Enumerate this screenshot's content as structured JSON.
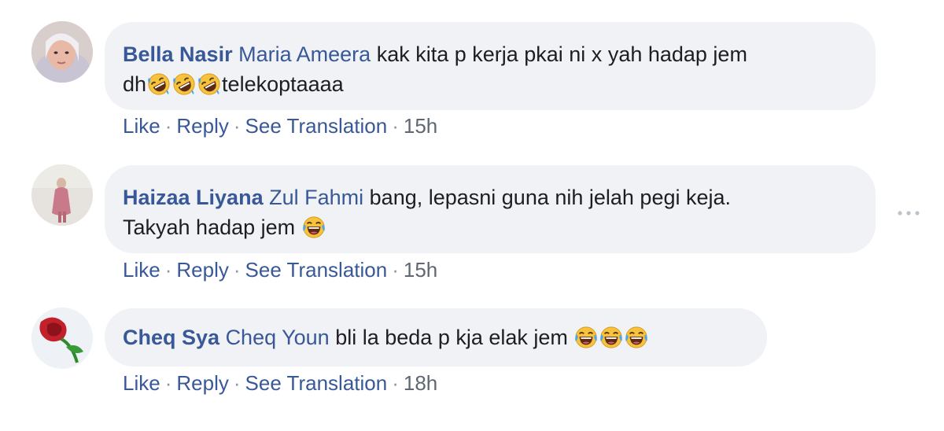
{
  "comments": [
    {
      "author": "Bella Nasir",
      "mention": "Maria Ameera",
      "text_line1": "kak kita p kerja pkai ni x yah hadap jem",
      "text_line2_pre": "dh",
      "text_line2_post": "telekoptaaaa",
      "emojis": [
        "rolling-laughing",
        "rolling-laughing",
        "rolling-laughing"
      ],
      "actions": {
        "like": "Like",
        "reply": "Reply",
        "translate": "See Translation",
        "time": "15h"
      }
    },
    {
      "author": "Haizaa Liyana",
      "mention": "Zul Fahmi",
      "text_line1": "bang, lepasni guna nih jelah pegi keja.",
      "text_line2_pre": "Takyah hadap jem",
      "emojis": [
        "tears-of-joy"
      ],
      "actions": {
        "like": "Like",
        "reply": "Reply",
        "translate": "See Translation",
        "time": "15h"
      }
    },
    {
      "author": "Cheq Sya",
      "mention": "Cheq Youn",
      "text_line1": "bli la beda p kja elak jem",
      "emojis": [
        "tears-of-joy",
        "tears-of-joy",
        "tears-of-joy"
      ],
      "actions": {
        "like": "Like",
        "reply": "Reply",
        "translate": "See Translation",
        "time": "18h"
      }
    }
  ],
  "colors": {
    "name": "#385898",
    "bubble": "#f0f2f5",
    "meta": "#606770"
  }
}
